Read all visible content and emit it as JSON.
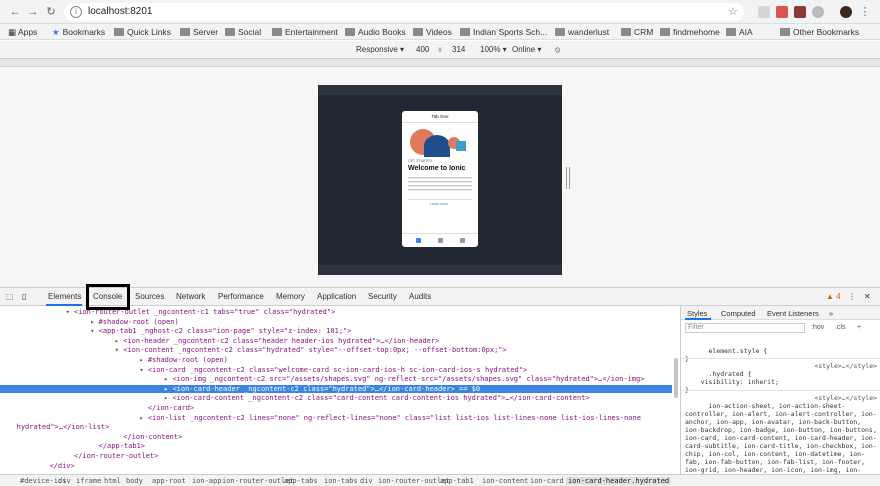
{
  "browser": {
    "url": "localhost:8201",
    "bookmarks": [
      {
        "label": "Apps",
        "kind": "apps"
      },
      {
        "label": "Bookmarks",
        "kind": "star"
      },
      {
        "label": "Quick Links",
        "kind": "folder"
      },
      {
        "label": "Server",
        "kind": "folder"
      },
      {
        "label": "Social",
        "kind": "folder"
      },
      {
        "label": "Entertainment",
        "kind": "folder"
      },
      {
        "label": "Audio Books",
        "kind": "folder"
      },
      {
        "label": "Videos",
        "kind": "folder"
      },
      {
        "label": "Indian Sports Sch...",
        "kind": "folder"
      },
      {
        "label": "wanderlust",
        "kind": "folder"
      },
      {
        "label": "CRM",
        "kind": "folder"
      },
      {
        "label": "findmehome",
        "kind": "folder"
      },
      {
        "label": "AIA",
        "kind": "folder"
      }
    ],
    "other_bookmarks": "Other Bookmarks"
  },
  "device_toolbar": {
    "mode": "Responsive ▾",
    "width": "400",
    "times": "x",
    "height": "314",
    "zoom": "100% ▾",
    "network": "Online ▾"
  },
  "phone": {
    "header": "Tab One",
    "subtitle": "GET STARTED",
    "title": "Welcome to Ionic",
    "link": "Learn more"
  },
  "devtools": {
    "tabs": [
      "Elements",
      "Console",
      "Sources",
      "Network",
      "Performance",
      "Memory",
      "Application",
      "Security",
      "Audits"
    ],
    "warn_count": "4",
    "elements_lines": [
      {
        "indent": 16,
        "tri": "▾",
        "text": "<ion-router-outlet _ngcontent-c1 tabs=\"true\" class=\"hydrated\">"
      },
      {
        "indent": 22,
        "tri": "▸",
        "text": "#shadow-root (open)"
      },
      {
        "indent": 22,
        "tri": "▾",
        "text": "<app-tab1 _nghost-c2 class=\"ion-page\" style=\"z-index: 101;\">"
      },
      {
        "indent": 28,
        "tri": "▸",
        "text": "<ion-header _ngcontent-c2 class=\"header header-ios hydrated\">…</ion-header>"
      },
      {
        "indent": 28,
        "tri": "▾",
        "text": "<ion-content _ngcontent-c2 class=\"hydrated\" style=\"--offset-top:0px; --offset-bottom:0px;\">"
      },
      {
        "indent": 34,
        "tri": "▸",
        "text": "#shadow-root (open)"
      },
      {
        "indent": 34,
        "tri": "▾",
        "text": "<ion-card _ngcontent-c2 class=\"welcome-card sc-ion-card-ios-h sc-ion-card-ios-s hydrated\">"
      },
      {
        "indent": 40,
        "tri": "▸",
        "text": "<ion-img _ngcontent-c2 src=\"/assets/shapes.svg\" ng-reflect-src=\"/assets/shapes.svg\" class=\"hydrated\">…</ion-img>"
      },
      {
        "indent": 40,
        "tri": "▸",
        "text": "<ion-card-header _ngcontent-c2 class=\"hydrated\">…</ion-card-header> == $0",
        "selected": true
      },
      {
        "indent": 40,
        "tri": "▸",
        "text": "<ion-card-content _ngcontent-c2 class=\"card-content card-content-ios hydrated\">…</ion-card-content>"
      },
      {
        "indent": 34,
        "tri": " ",
        "text": "</ion-card>"
      },
      {
        "indent": 34,
        "tri": "▸",
        "text": "<ion-list _ngcontent-c2 lines=\"none\" ng-reflect-lines=\"none\" class=\"list list-ios list-lines-none list-ios-lines-none"
      },
      {
        "indent": 2,
        "tri": " ",
        "text": "hydrated\">…</ion-list>"
      },
      {
        "indent": 28,
        "tri": " ",
        "text": "</ion-content>"
      },
      {
        "indent": 22,
        "tri": " ",
        "text": "</app-tab1>"
      },
      {
        "indent": 16,
        "tri": " ",
        "text": "</ion-router-outlet>"
      },
      {
        "indent": 10,
        "tri": " ",
        "text": "</div>"
      }
    ],
    "styles_tabs": [
      "Styles",
      "Computed",
      "Event Listeners",
      "»"
    ],
    "filter_placeholder": "Filter",
    "hov": ":hov",
    "cls": ".cls",
    "plus": "+",
    "rules": [
      {
        "text": "element.style {\n}",
        "src": ""
      },
      {
        "text": ".hydrated {\n    visibility: inherit;\n}",
        "src": "<style>…</style>"
      },
      {
        "text": "ion-action-sheet, ion-action-sheet-controller, ion-alert, ion-alert-controller, ion-anchor, ion-app, ion-avatar, ion-back-button, ion-backdrop, ion-badge, ion-button, ion-buttons, ion-card, ion-card-content, ion-card-header, ion-card-subtitle, ion-card-title, ion-checkbox, ion-chip, ion-col, ion-content, ion-datetime, ion-fab, ion-fab-button, ion-fab-list, ion-footer, ion-grid, ion-header, ion-icon, ion-img, ion-infinite-scroll, ion-infinite-scroll-content, ion-input, ion-item, ion-",
        "src": "<style>…</style>"
      }
    ],
    "breadcrumbs": [
      "#device-ios",
      "div",
      "iframe",
      "html",
      "body",
      "app-root",
      "ion-app",
      "ion-router-outlet",
      "app-tabs",
      "ion-tabs",
      "div",
      "ion-router-outlet",
      "app-tab1",
      "ion-content",
      "ion-card",
      "ion-card-header.hydrated"
    ]
  },
  "colors": {
    "selection": "#3b84e2",
    "tag": "#881280",
    "accent": "#1a73e8"
  }
}
